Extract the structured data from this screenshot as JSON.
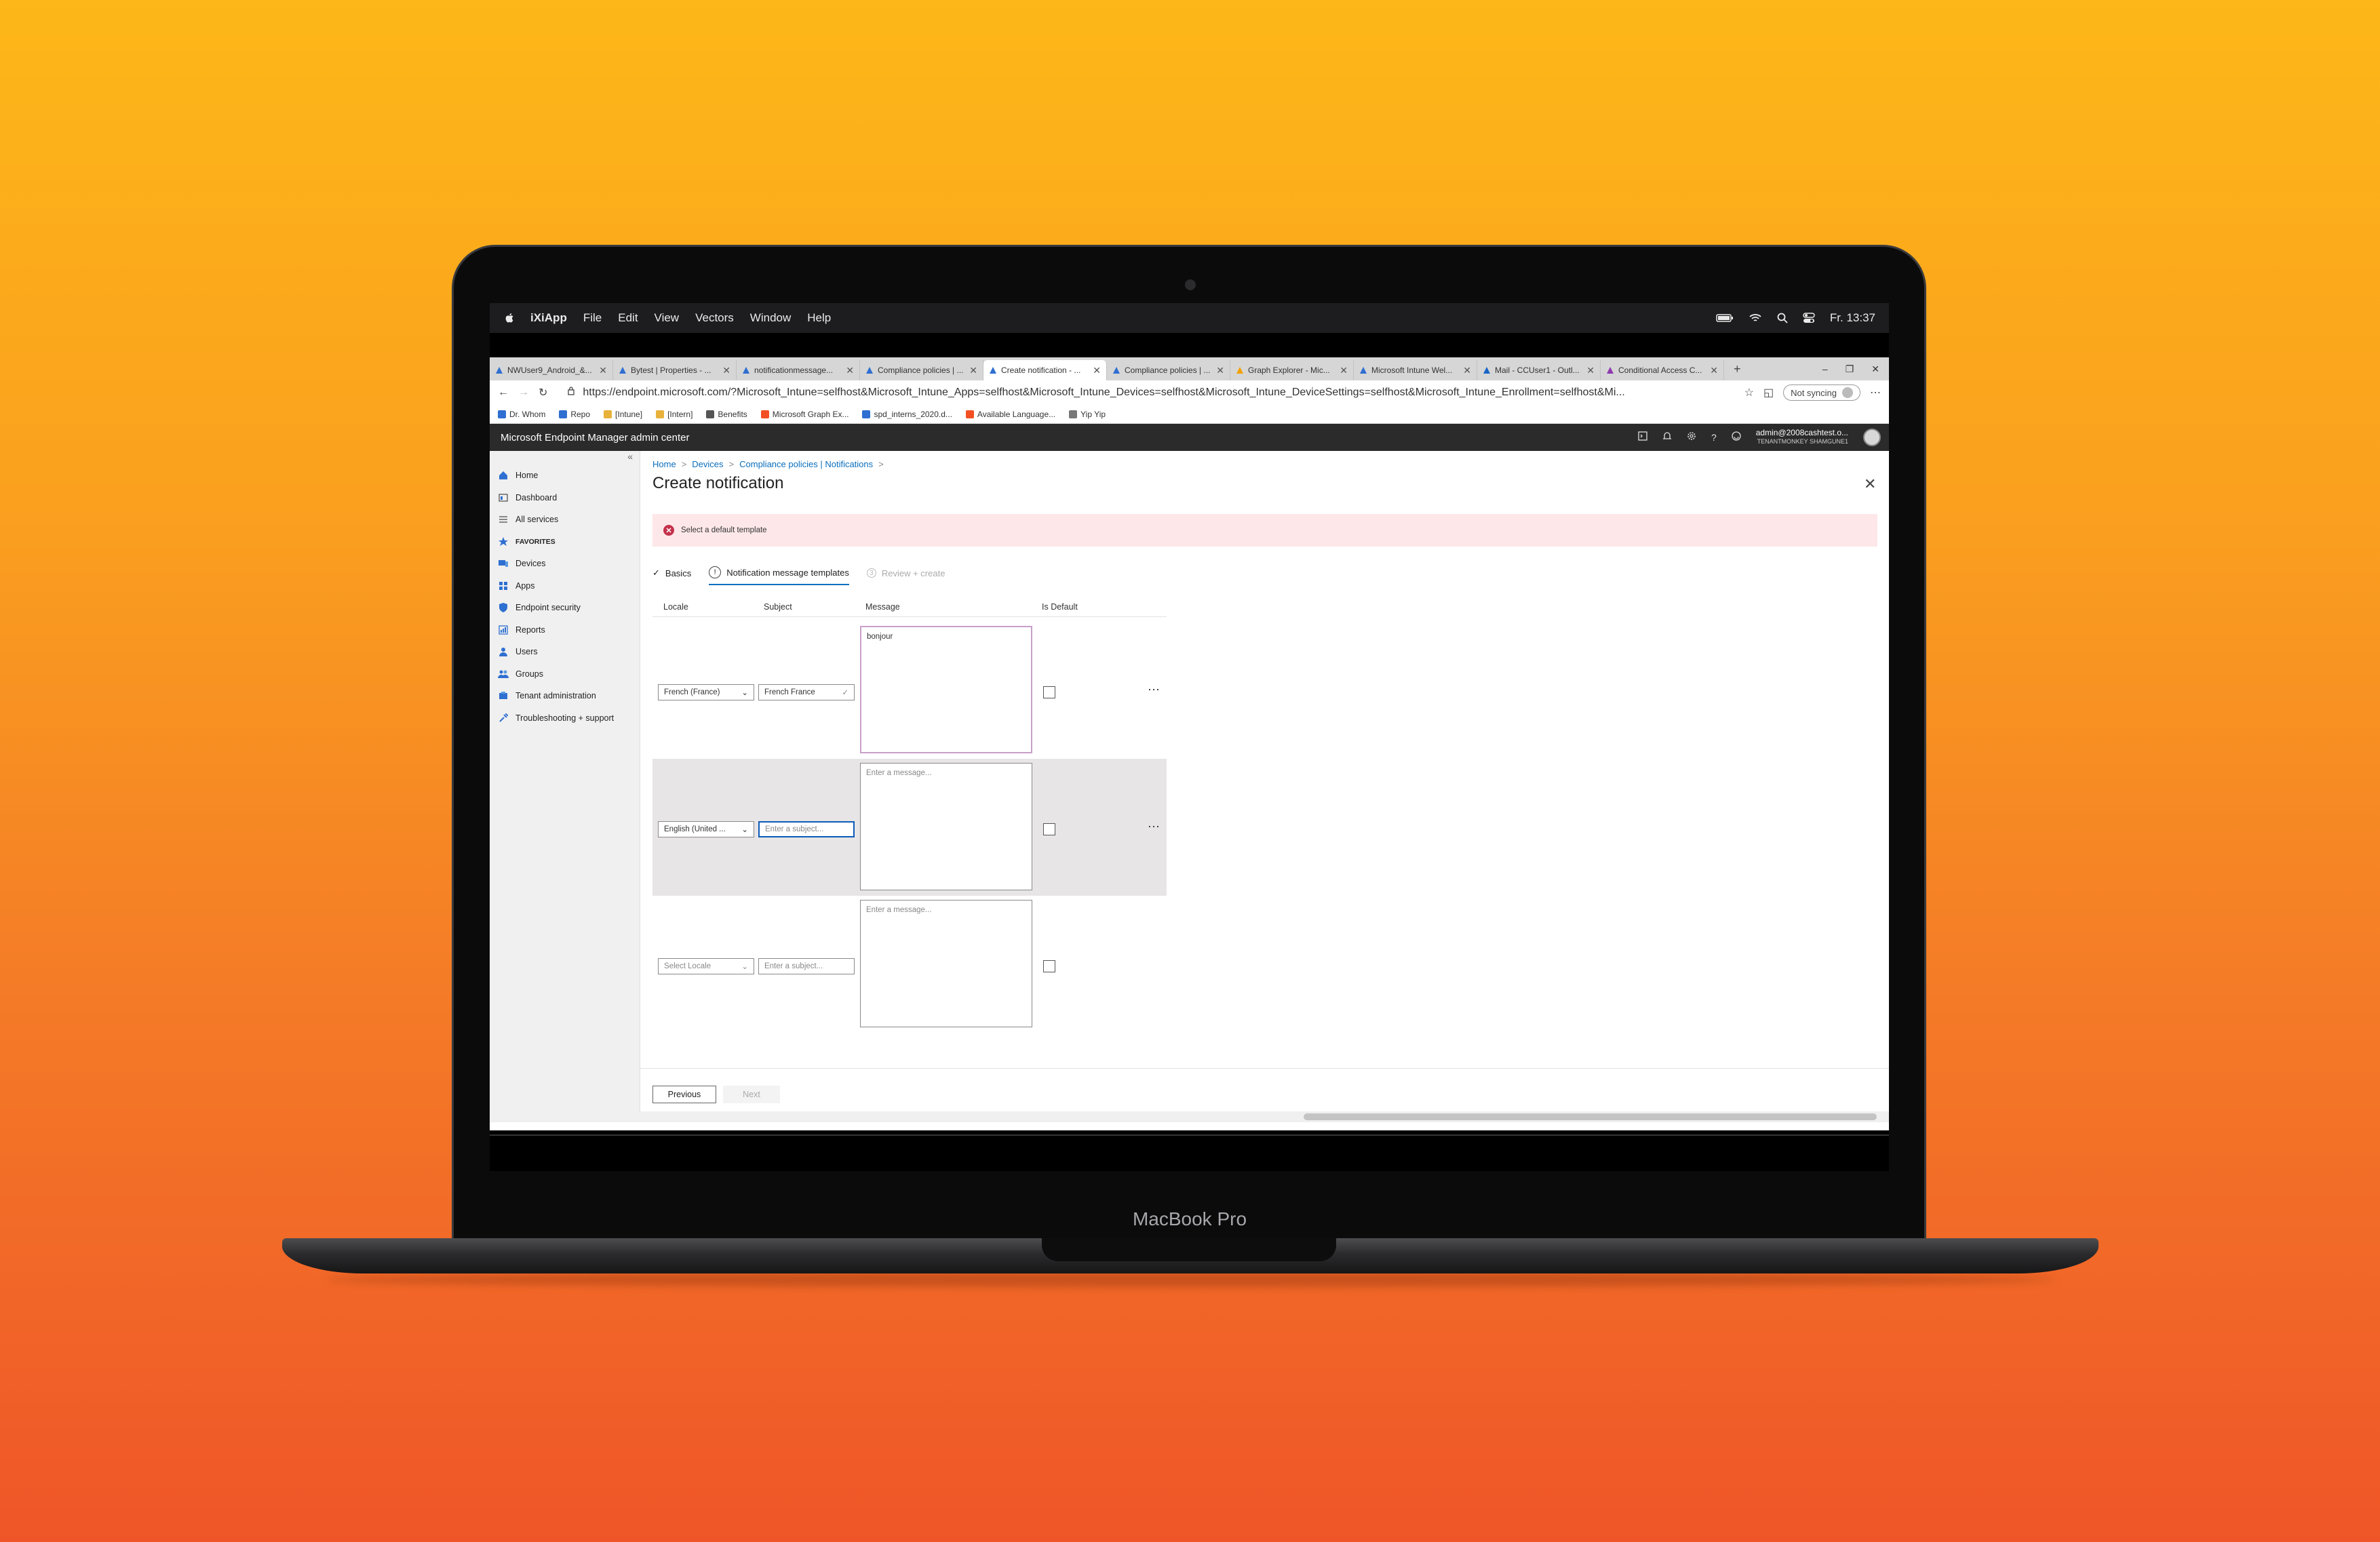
{
  "menubar": {
    "app": "iXiApp",
    "items": [
      "File",
      "Edit",
      "View",
      "Vectors",
      "Window",
      "Help"
    ],
    "clock": "Fr. 13:37"
  },
  "browser": {
    "tabs": [
      {
        "label": "NWUser9_Android_&...",
        "icon": "azure-icon",
        "color": "#2f6fd1"
      },
      {
        "label": "Bytest | Properties - ...",
        "icon": "azure-icon",
        "color": "#2f6fd1"
      },
      {
        "label": "notificationmessage...",
        "icon": "graph-icon",
        "color": "#2f6fd1"
      },
      {
        "label": "Compliance policies | ...",
        "icon": "azure-icon",
        "color": "#2f6fd1"
      },
      {
        "label": "Create notification - ...",
        "icon": "azure-icon",
        "color": "#2f6fd1",
        "active": true
      },
      {
        "label": "Compliance policies | ...",
        "icon": "azure-icon",
        "color": "#2f6fd1"
      },
      {
        "label": "Graph Explorer - Mic...",
        "icon": "graph-explorer-icon",
        "color": "#f2a100"
      },
      {
        "label": "Microsoft Intune Wel...",
        "icon": "intune-icon",
        "color": "#2f6fd1"
      },
      {
        "label": "Mail - CCUser1 - Outl...",
        "icon": "outlook-icon",
        "color": "#1a66c7"
      },
      {
        "label": "Conditional Access C...",
        "icon": "onenote-icon",
        "color": "#8e3bb0"
      }
    ],
    "url": "https://endpoint.microsoft.com/?Microsoft_Intune=selfhost&Microsoft_Intune_Apps=selfhost&Microsoft_Intune_Devices=selfhost&Microsoft_Intune_DeviceSettings=selfhost&Microsoft_Intune_Enrollment=selfhost&Mi...",
    "sync_label": "Not syncing",
    "favorites": [
      {
        "label": "Dr. Whom",
        "color": "#2f6fd1"
      },
      {
        "label": "Repo",
        "color": "#2f6fd1"
      },
      {
        "label": "[Intune]",
        "color": "#e8b13a"
      },
      {
        "label": "[Intern]",
        "color": "#e8b13a"
      },
      {
        "label": "Benefits",
        "color": "#555555"
      },
      {
        "label": "Microsoft Graph Ex...",
        "color": "#f25022"
      },
      {
        "label": "spd_interns_2020.d...",
        "color": "#2f6fd1"
      },
      {
        "label": "Available Language...",
        "color": "#f25022"
      },
      {
        "label": "Yip Yip",
        "color": "#777777"
      }
    ]
  },
  "portal": {
    "title": "Microsoft Endpoint Manager admin center",
    "account": "admin@2008cashtest.o...",
    "tenant": "TENANTMONKEY SHAMGUNE1"
  },
  "sidebar": {
    "items": [
      {
        "label": "Home",
        "icon": "home-icon",
        "bold": false
      },
      {
        "label": "Dashboard",
        "icon": "dashboard-icon",
        "bold": false
      },
      {
        "label": "All services",
        "icon": "all-services-icon",
        "bold": false
      },
      {
        "label": "FAVORITES",
        "icon": "star-icon",
        "bold": true
      },
      {
        "label": "Devices",
        "icon": "devices-icon",
        "bold": false
      },
      {
        "label": "Apps",
        "icon": "apps-icon",
        "bold": false
      },
      {
        "label": "Endpoint security",
        "icon": "shield-icon",
        "bold": false
      },
      {
        "label": "Reports",
        "icon": "reports-icon",
        "bold": false
      },
      {
        "label": "Users",
        "icon": "user-icon",
        "bold": false
      },
      {
        "label": "Groups",
        "icon": "groups-icon",
        "bold": false
      },
      {
        "label": "Tenant administration",
        "icon": "tenant-admin-icon",
        "bold": false
      },
      {
        "label": "Troubleshooting + support",
        "icon": "wrench-icon",
        "bold": false
      }
    ]
  },
  "main": {
    "breadcrumb": [
      "Home",
      "Devices",
      "Compliance policies | Notifications"
    ],
    "title": "Create notification",
    "error": "Select a default template",
    "steps": [
      {
        "label": "Basics",
        "state": "done"
      },
      {
        "label": "Notification message templates",
        "state": "current"
      },
      {
        "label": "Review + create",
        "state": "disabled",
        "num": "3"
      }
    ],
    "columns": {
      "locale": "Locale",
      "subject": "Subject",
      "message": "Message",
      "is_default": "Is Default"
    },
    "rows": [
      {
        "locale": "French (France)",
        "subject": "French France",
        "message": "bonjour",
        "locale_placeholder": false,
        "subject_placeholder": false,
        "message_placeholder": false,
        "is_default": false
      },
      {
        "locale": "English (United ...",
        "subject": "Enter a subject...",
        "message": "Enter a message...",
        "locale_placeholder": false,
        "subject_placeholder": true,
        "message_placeholder": true,
        "is_default": false
      },
      {
        "locale": "Select Locale",
        "subject": "Enter a subject...",
        "message": "Enter a message...",
        "locale_placeholder": true,
        "subject_placeholder": true,
        "message_placeholder": true,
        "is_default": false
      }
    ],
    "previous_label": "Previous",
    "next_label": "Next"
  },
  "device_label": "MacBook Pro",
  "colors": {
    "accent": "#0a6ebd",
    "error": "#c4314b",
    "error_bg": "#fde7e9",
    "bg_top": "#fdb718",
    "bg_bottom": "#ef5528"
  }
}
